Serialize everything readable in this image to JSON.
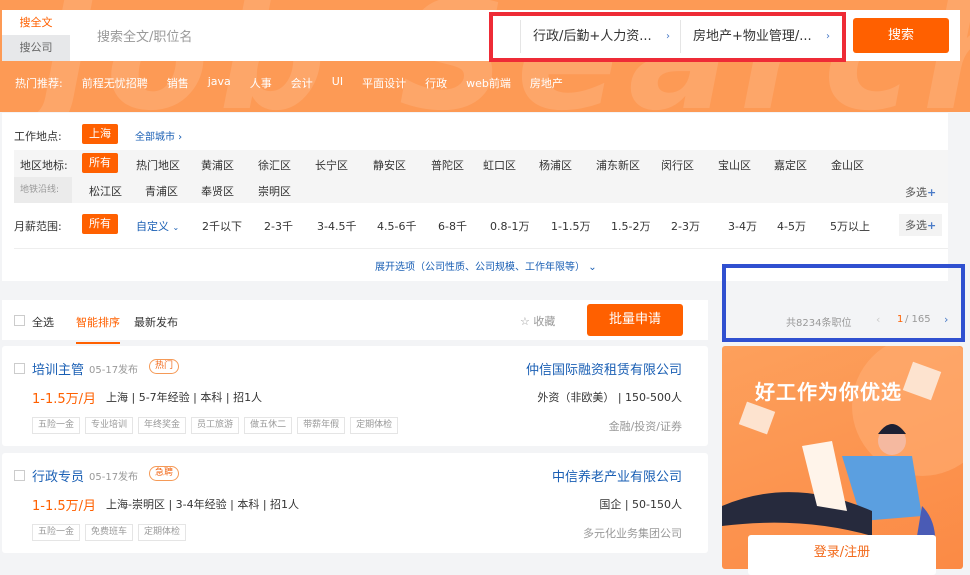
{
  "search": {
    "tab_fulltext": "搜全文",
    "tab_company": "搜公司",
    "placeholder": "搜索全文/职位名",
    "function_select": "行政/后勤+人力资...",
    "industry_select": "房地产+物业管理/...",
    "button": "搜索"
  },
  "hot": {
    "label": "热门推荐:",
    "items": [
      "前程无忧招聘",
      "销售",
      "java",
      "人事",
      "会计",
      "UI",
      "平面设计",
      "行政",
      "web前端",
      "房地产"
    ]
  },
  "filters": {
    "location_label": "工作地点:",
    "location_value": "上海",
    "all_cities": "全部城市 ›",
    "district_label": "地区地标:",
    "metro_label": "地铁沿线:",
    "district_all": "所有",
    "districts": [
      "热门地区",
      "黄浦区",
      "徐汇区",
      "长宁区",
      "静安区",
      "普陀区",
      "虹口区",
      "杨浦区",
      "浦东新区",
      "闵行区",
      "宝山区",
      "嘉定区",
      "金山区",
      "松江区",
      "青浦区",
      "奉贤区",
      "崇明区"
    ],
    "multi": "多选",
    "salary_label": "月薪范围:",
    "salary_all": "所有",
    "salary_custom": "自定义",
    "salaries": [
      "2千以下",
      "2-3千",
      "3-4.5千",
      "4.5-6千",
      "6-8千",
      "0.8-1万",
      "1-1.5万",
      "1.5-2万",
      "2-3万",
      "3-4万",
      "4-5万",
      "5万以上"
    ],
    "expand": "展开选项（公司性质、公司规模、工作年限等）"
  },
  "list": {
    "select_all": "全选",
    "sort_smart": "智能排序",
    "sort_new": "最新发布",
    "favorite": "收藏",
    "batch_apply": "批量申请",
    "total": "共8234条职位",
    "page_current": "1",
    "page_total": "/ 165"
  },
  "jobs": [
    {
      "title": "培训主管",
      "date": "05-17发布",
      "badge": "热门",
      "salary": "1-1.5万/月",
      "meta": "上海 | 5-7年经验 | 本科 | 招1人",
      "tags": [
        "五险一金",
        "专业培训",
        "年终奖金",
        "员工旅游",
        "做五休二",
        "带薪年假",
        "定期体检"
      ],
      "company": "仲信国际融资租赁有限公司",
      "company_info": "外资（非欧美） | 150-500人",
      "industry": "金融/投资/证券"
    },
    {
      "title": "行政专员",
      "date": "05-17发布",
      "badge": "急聘",
      "salary": "1-1.5万/月",
      "meta": "上海-崇明区 | 3-4年经验 | 本科 | 招1人",
      "tags": [
        "五险一金",
        "免费班车",
        "定期体检"
      ],
      "company": "中信养老产业有限公司",
      "company_info": "国企 | 50-150人",
      "industry": "多元化业务集团公司"
    }
  ],
  "ad": {
    "title": "好工作为你优选",
    "login": "登录/注册"
  }
}
